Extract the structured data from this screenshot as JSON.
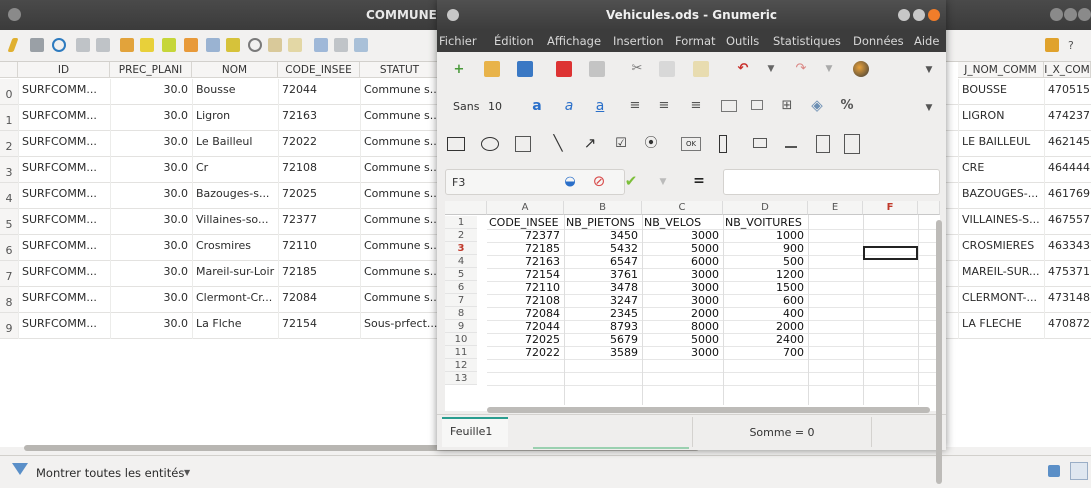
{
  "qgis": {
    "title_fragment": "COMMUNE",
    "columns": [
      "ID",
      "PREC_PLANI",
      "NOM",
      "CODE_INSEE",
      "STATUT",
      "J_NOM_COMM",
      "I_X_COM"
    ],
    "rows": [
      {
        "n": "0",
        "id": "SURFCOMM...",
        "prec": "30.0",
        "nom": "Bousse",
        "insee": "72044",
        "statut": "Commune s...",
        "nomcomm": "BOUSSE",
        "xcom": "470515"
      },
      {
        "n": "1",
        "id": "SURFCOMM...",
        "prec": "30.0",
        "nom": "Ligron",
        "insee": "72163",
        "statut": "Commune s...",
        "nomcomm": "LIGRON",
        "xcom": "474237"
      },
      {
        "n": "2",
        "id": "SURFCOMM...",
        "prec": "30.0",
        "nom": "Le Bailleul",
        "insee": "72022",
        "statut": "Commune s...",
        "nomcomm": "LE BAILLEUL",
        "xcom": "462145"
      },
      {
        "n": "3",
        "id": "SURFCOMM...",
        "prec": "30.0",
        "nom": "Cr",
        "insee": "72108",
        "statut": "Commune s...",
        "nomcomm": "CRE",
        "xcom": "464444"
      },
      {
        "n": "4",
        "id": "SURFCOMM...",
        "prec": "30.0",
        "nom": "Bazouges-s...",
        "insee": "72025",
        "statut": "Commune s...",
        "nomcomm": "BAZOUGES-...",
        "xcom": "461769"
      },
      {
        "n": "5",
        "id": "SURFCOMM...",
        "prec": "30.0",
        "nom": "Villaines-so...",
        "insee": "72377",
        "statut": "Commune s...",
        "nomcomm": "VILLAINES-S...",
        "xcom": "467557"
      },
      {
        "n": "6",
        "id": "SURFCOMM...",
        "prec": "30.0",
        "nom": "Crosmires",
        "insee": "72110",
        "statut": "Commune s...",
        "nomcomm": "CROSMIERES",
        "xcom": "463343"
      },
      {
        "n": "7",
        "id": "SURFCOMM...",
        "prec": "30.0",
        "nom": "Mareil-sur-Loir",
        "insee": "72185",
        "statut": "Commune s...",
        "nomcomm": "MAREIL-SUR...",
        "xcom": "475371"
      },
      {
        "n": "8",
        "id": "SURFCOMM...",
        "prec": "30.0",
        "nom": "Clermont-Cr...",
        "insee": "72084",
        "statut": "Commune s...",
        "nomcomm": "CLERMONT-...",
        "xcom": "473148"
      },
      {
        "n": "9",
        "id": "SURFCOMM...",
        "prec": "30.0",
        "nom": "La Flche",
        "insee": "72154",
        "statut": "Sous-prfect...",
        "nomcomm": "LA FLECHE",
        "xcom": "470872"
      }
    ],
    "filter_label": "Montrer toutes les entités"
  },
  "gnumeric": {
    "title": "Vehicules.ods - Gnumeric",
    "menu": [
      "Fichier",
      "Édition",
      "Affichage",
      "Insertion",
      "Format",
      "Outils",
      "Statistiques",
      "Données",
      "Aide"
    ],
    "font_name": "Sans",
    "font_size": "10",
    "cell_ref": "F3",
    "col_letters": [
      "A",
      "B",
      "C",
      "D",
      "E",
      "F"
    ],
    "header_row": [
      "CODE_INSEE",
      "NB_PIETONS",
      "NB_VELOS",
      "NB_VOITURES"
    ],
    "data_rows": [
      [
        "72377",
        "3450",
        "3000",
        "1000"
      ],
      [
        "72185",
        "5432",
        "5000",
        "900"
      ],
      [
        "72163",
        "6547",
        "6000",
        "500"
      ],
      [
        "72154",
        "3761",
        "3000",
        "1200"
      ],
      [
        "72110",
        "3478",
        "3000",
        "1500"
      ],
      [
        "72108",
        "3247",
        "3000",
        "600"
      ],
      [
        "72084",
        "2345",
        "2000",
        "400"
      ],
      [
        "72044",
        "8793",
        "8000",
        "2000"
      ],
      [
        "72025",
        "5679",
        "5000",
        "2400"
      ],
      [
        "72022",
        "3589",
        "3000",
        "700"
      ]
    ],
    "row_numbers": [
      "1",
      "2",
      "3",
      "4",
      "5",
      "6",
      "7",
      "8",
      "9",
      "10",
      "11",
      "12",
      "13"
    ],
    "sheet_tab": "Feuille1",
    "status_sum": "Somme = 0"
  }
}
